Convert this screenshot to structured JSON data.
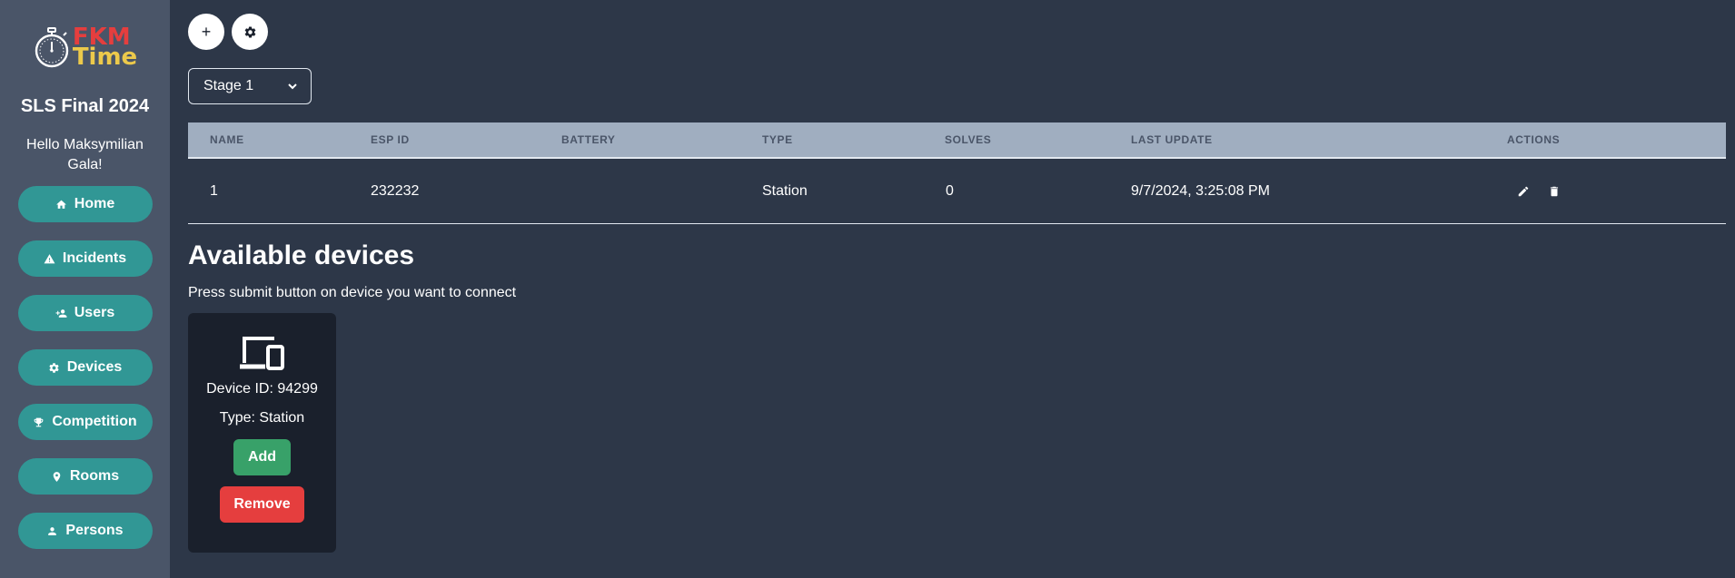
{
  "sidebar": {
    "logo": {
      "line1": "FKM",
      "line2": "Time",
      "icon": "stopwatch-icon"
    },
    "competition_name": "SLS Final 2024",
    "greeting": "Hello Maksymilian Gala!",
    "nav": [
      {
        "label": "Home",
        "icon": "home-icon"
      },
      {
        "label": "Incidents",
        "icon": "warning-icon"
      },
      {
        "label": "Users",
        "icon": "user-add-icon"
      },
      {
        "label": "Devices",
        "icon": "gear-icon"
      },
      {
        "label": "Competition",
        "icon": "trophy-icon"
      },
      {
        "label": "Rooms",
        "icon": "map-pin-icon"
      },
      {
        "label": "Persons",
        "icon": "person-icon"
      }
    ]
  },
  "toolbar": {
    "add_label": "+",
    "settings_icon": "gear-icon"
  },
  "stage_select": {
    "value": "Stage 1"
  },
  "table": {
    "headers": [
      "NAME",
      "ESP ID",
      "BATTERY",
      "TYPE",
      "SOLVES",
      "LAST UPDATE",
      "ACTIONS"
    ],
    "rows": [
      {
        "name": "1",
        "esp_id": "232232",
        "battery": "",
        "type": "Station",
        "solves": "0",
        "last_update": "9/7/2024, 3:25:08 PM"
      }
    ]
  },
  "available": {
    "title": "Available devices",
    "subtitle": "Press submit button on device you want to connect",
    "devices": [
      {
        "id_text": "Device ID: 94299",
        "type_text": "Type: Station",
        "add_label": "Add",
        "remove_label": "Remove",
        "icon": "devices-icon"
      }
    ]
  },
  "colors": {
    "background": "#2d3748",
    "sidebar": "#4a5568",
    "nav_button": "#319795",
    "add_button": "#38a169",
    "remove_button": "#e53e3e",
    "table_header": "#a0aec0",
    "card": "#1a202c"
  }
}
